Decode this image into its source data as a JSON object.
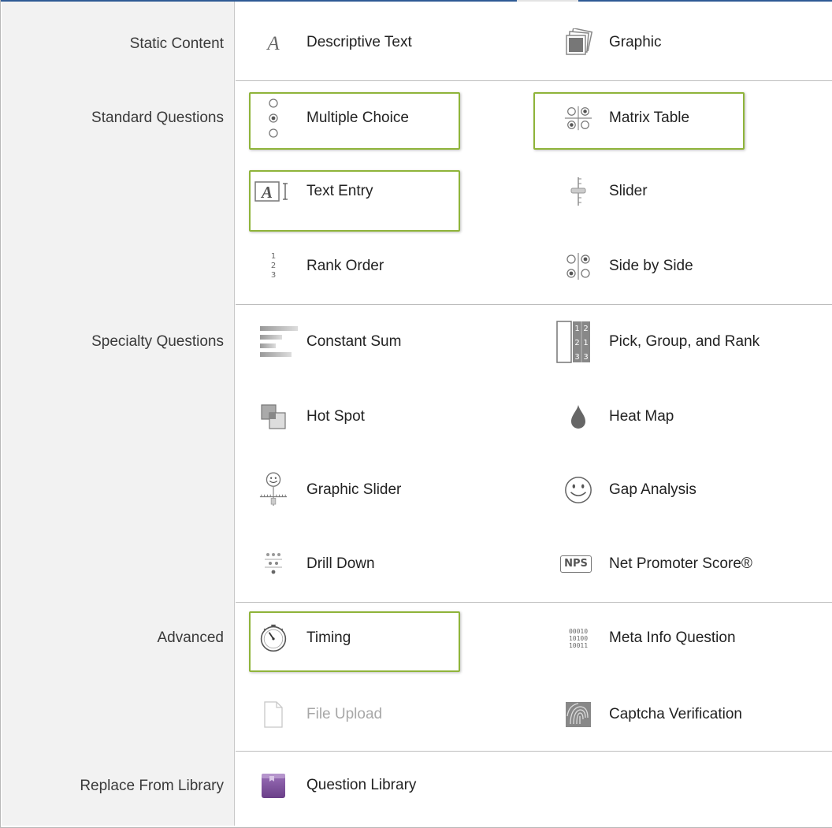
{
  "sections": [
    {
      "id": "static",
      "label": "Static Content"
    },
    {
      "id": "standard",
      "label": "Standard Questions"
    },
    {
      "id": "specialty",
      "label": "Specialty Questions"
    },
    {
      "id": "advanced",
      "label": "Advanced"
    },
    {
      "id": "library",
      "label": "Replace From Library"
    }
  ],
  "items": {
    "descriptive_text": {
      "label": "Descriptive Text",
      "icon": "descriptive-text-icon"
    },
    "graphic": {
      "label": "Graphic",
      "icon": "graphic-icon"
    },
    "multiple_choice": {
      "label": "Multiple Choice",
      "icon": "multiple-choice-icon",
      "highlighted": true
    },
    "matrix_table": {
      "label": "Matrix Table",
      "icon": "matrix-table-icon",
      "highlighted": true
    },
    "text_entry": {
      "label": "Text Entry",
      "icon": "text-entry-icon",
      "highlighted": true
    },
    "slider": {
      "label": "Slider",
      "icon": "slider-icon"
    },
    "rank_order": {
      "label": "Rank Order",
      "icon": "rank-order-icon",
      "icon_text": [
        "1",
        "2",
        "3"
      ]
    },
    "side_by_side": {
      "label": "Side by Side",
      "icon": "side-by-side-icon"
    },
    "constant_sum": {
      "label": "Constant Sum",
      "icon": "constant-sum-icon"
    },
    "pick_group_rank": {
      "label": "Pick, Group, and Rank",
      "icon": "pick-group-rank-icon"
    },
    "hot_spot": {
      "label": "Hot Spot",
      "icon": "hot-spot-icon"
    },
    "heat_map": {
      "label": "Heat Map",
      "icon": "heat-map-icon"
    },
    "graphic_slider": {
      "label": "Graphic Slider",
      "icon": "graphic-slider-icon"
    },
    "gap_analysis": {
      "label": "Gap Analysis",
      "icon": "gap-analysis-icon"
    },
    "drill_down": {
      "label": "Drill Down",
      "icon": "drill-down-icon"
    },
    "nps": {
      "label": "Net Promoter Score®",
      "icon": "nps-icon",
      "icon_text": "NPS"
    },
    "timing": {
      "label": "Timing",
      "icon": "timing-icon",
      "highlighted": true
    },
    "meta_info": {
      "label": "Meta Info Question",
      "icon": "meta-info-icon",
      "icon_text": [
        "00010",
        "10100",
        "10011"
      ]
    },
    "file_upload": {
      "label": "File Upload",
      "icon": "file-upload-icon",
      "disabled": true
    },
    "captcha": {
      "label": "Captcha Verification",
      "icon": "captcha-icon"
    },
    "question_library": {
      "label": "Question Library",
      "icon": "question-library-icon"
    }
  },
  "colors": {
    "highlight": "#8fb43a",
    "sidebar_bg": "#f2f2f2",
    "library_purple": "#7a4f9a"
  }
}
